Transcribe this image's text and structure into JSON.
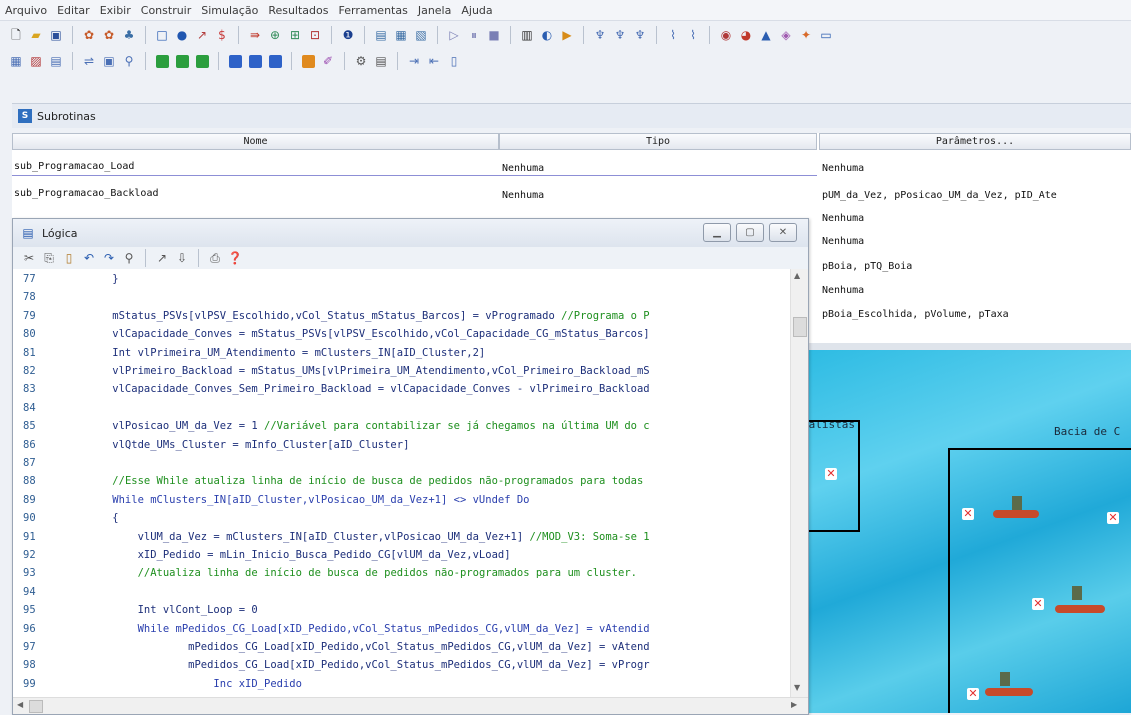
{
  "menu": [
    "Arquivo",
    "Editar",
    "Exibir",
    "Construir",
    "Simulação",
    "Resultados",
    "Ferramentas",
    "Janela",
    "Ajuda"
  ],
  "subrotinas": {
    "title": "Subrotinas",
    "columns": [
      "Nome",
      "Tipo",
      "Parâmetros..."
    ],
    "rows": [
      {
        "nome": "sub_Programacao_Load",
        "tipo": "Nenhuma",
        "param": "Nenhuma"
      },
      {
        "nome": "sub_Programacao_Backload",
        "tipo": "Nenhuma",
        "param": "pUM_da_Vez, pPosicao_UM_da_Vez, pID_Ate"
      }
    ],
    "extra_params": [
      "Nenhuma",
      "Nenhuma",
      "pBoia, pTQ_Boia",
      "Nenhuma",
      "pBoia_Escolhida, pVolume, pTaxa"
    ]
  },
  "map": {
    "label_left": "ialistas",
    "label_right": "Bacia de C"
  },
  "logic": {
    "title": "Lógica",
    "lines": [
      {
        "n": "77",
        "t": "    }",
        "c": "txt"
      },
      {
        "n": "78",
        "t": "",
        "c": "txt"
      },
      {
        "n": "79",
        "t": "    mStatus_PSVs[vlPSV_Escolhido,vCol_Status_mStatus_Barcos] = vProgramado ",
        "c": "txt",
        "cm": "//Programa o P"
      },
      {
        "n": "80",
        "t": "    vlCapacidade_Conves = mStatus_PSVs[vlPSV_Escolhido,vCol_Capacidade_CG_mStatus_Barcos]",
        "c": "txt"
      },
      {
        "n": "81",
        "t": "    Int vlPrimeira_UM_Atendimento = mClusters_IN[aID_Cluster,2]",
        "c": "txt"
      },
      {
        "n": "82",
        "t": "    vlPrimeiro_Backload = mStatus_UMs[vlPrimeira_UM_Atendimento,vCol_Primeiro_Backload_mS",
        "c": "txt"
      },
      {
        "n": "83",
        "t": "    vlCapacidade_Conves_Sem_Primeiro_Backload = vlCapacidade_Conves - vlPrimeiro_Backload",
        "c": "txt"
      },
      {
        "n": "84",
        "t": "",
        "c": "txt"
      },
      {
        "n": "85",
        "t": "    vlPosicao_UM_da_Vez = 1 ",
        "c": "txt",
        "cm": "//Variável para contabilizar se já chegamos na última UM do c"
      },
      {
        "n": "86",
        "t": "    vlQtde_UMs_Cluster = mInfo_Cluster[aID_Cluster]",
        "c": "txt"
      },
      {
        "n": "87",
        "t": "",
        "c": "txt"
      },
      {
        "n": "88",
        "t": "    ",
        "c": "txt",
        "cm": "//Esse While atualiza linha de início de busca de pedidos não-programados para todas"
      },
      {
        "n": "89",
        "t": "    While mClusters_IN[aID_Cluster,vlPosicao_UM_da_Vez+1] <> vUndef Do",
        "c": "kw"
      },
      {
        "n": "90",
        "t": "    {",
        "c": "txt"
      },
      {
        "n": "91",
        "t": "        vlUM_da_Vez = mClusters_IN[aID_Cluster,vlPosicao_UM_da_Vez+1] ",
        "c": "txt",
        "cm": "//MOD_V3: Soma-se 1"
      },
      {
        "n": "92",
        "t": "        xID_Pedido = mLin_Inicio_Busca_Pedido_CG[vlUM_da_Vez,vLoad]",
        "c": "txt"
      },
      {
        "n": "93",
        "t": "        ",
        "c": "txt",
        "cm": "//Atualiza linha de início de busca de pedidos não-programados para um cluster."
      },
      {
        "n": "94",
        "t": "",
        "c": "txt"
      },
      {
        "n": "95",
        "t": "        Int vlCont_Loop = 0",
        "c": "txt"
      },
      {
        "n": "96",
        "t": "        While mPedidos_CG_Load[xID_Pedido,vCol_Status_mPedidos_CG,vlUM_da_Vez] = vAtendid",
        "c": "kw"
      },
      {
        "n": "97",
        "t": "                mPedidos_CG_Load[xID_Pedido,vCol_Status_mPedidos_CG,vlUM_da_Vez] = vAtend",
        "c": "txt"
      },
      {
        "n": "98",
        "t": "                mPedidos_CG_Load[xID_Pedido,vCol_Status_mPedidos_CG,vlUM_da_Vez] = vProgr",
        "c": "txt"
      },
      {
        "n": "99",
        "t": "                    Inc xID_Pedido",
        "c": "kw"
      }
    ]
  }
}
